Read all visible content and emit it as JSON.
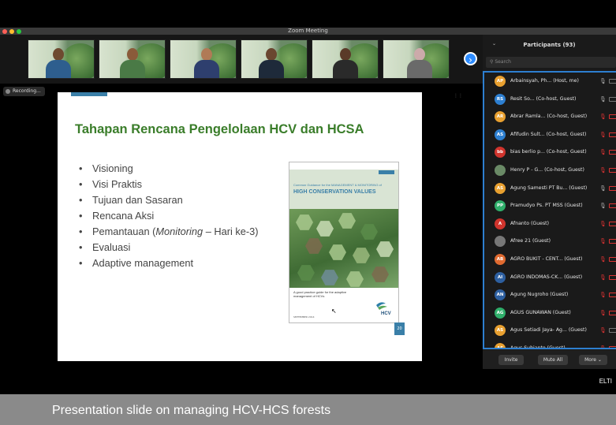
{
  "window": {
    "title": "Zoom Meeting"
  },
  "recording": {
    "label": "Recording..."
  },
  "thumbnails": [
    {
      "name": "",
      "shirt": "#2e5e8e",
      "skin": "#6e4a30"
    },
    {
      "name": "",
      "shirt": "#4a7a46",
      "skin": "#8a5b3a"
    },
    {
      "name": "",
      "shirt": "#2e3f6e",
      "skin": "#b07a56"
    },
    {
      "name": "",
      "shirt": "#1e2a3a",
      "skin": "#6a4630"
    },
    {
      "name": "",
      "shirt": "#2a2a2a",
      "skin": "#5a3a28"
    },
    {
      "name": "",
      "shirt": "#6a6a6a",
      "skin": "#caa"
    }
  ],
  "slide": {
    "title": "Tahapan Rencana Pengelolaan HCV dan HCSA",
    "bullets": [
      "Visioning",
      "Visi Praktis",
      "Tujuan dan Sasaran",
      "Rencana Aksi",
      "Evaluasi",
      "Adaptive management"
    ],
    "bullet_monitoring": {
      "before": "Pemantauan (",
      "italic": "Monitoring",
      "after": " – Hari ke-3)"
    },
    "page_number": "20",
    "book": {
      "small_title": "Common Guidance for the MANAGEMENT & MONITORING of",
      "big_title": "HIGH CONSERVATION VALUES",
      "description": "A good practice guide for the adaptive management of HCVs",
      "date": "SEPTEMBER 2014",
      "logo_text": "HCV"
    }
  },
  "participants": {
    "header": "Participants (93)",
    "search_placeholder": "Search",
    "list": [
      {
        "initials": "AP",
        "color": "#e8a030",
        "name": "Arbainsyah, Ph... (Host, me)",
        "mic": "on",
        "video": "on",
        "photo": false
      },
      {
        "initials": "RS",
        "color": "#2d7fd0",
        "name": "Resit So... (Co-host, Guest)",
        "mic": "on",
        "video": "on",
        "photo": false
      },
      {
        "initials": "AR",
        "color": "#e8a030",
        "name": "Abrar Ramla... (Co-host, Guest)",
        "mic": "muted",
        "video": "off",
        "photo": false
      },
      {
        "initials": "AS",
        "color": "#2d7fd0",
        "name": "Afifudin Sult... (Co-host, Guest)",
        "mic": "muted",
        "video": "off",
        "photo": false
      },
      {
        "initials": "bb",
        "color": "#d0342d",
        "name": "bias berlio p... (Co-host, Guest)",
        "mic": "muted",
        "video": "off",
        "photo": false
      },
      {
        "initials": "",
        "color": "#6a8a66",
        "name": "Henry P - G... (Co-host, Guest)",
        "mic": "muted",
        "video": "off",
        "photo": true
      },
      {
        "initials": "AS",
        "color": "#e8a030",
        "name": "Agung Samesti PT Bu... (Guest)",
        "mic": "on",
        "video": "off",
        "photo": false
      },
      {
        "initials": "PP",
        "color": "#2fae6a",
        "name": "Pramudyo Ps. PT MSS (Guest)",
        "mic": "on",
        "video": "off",
        "photo": false
      },
      {
        "initials": "A",
        "color": "#d0342d",
        "name": "Afnanto (Guest)",
        "mic": "muted",
        "video": "off",
        "photo": false
      },
      {
        "initials": "",
        "color": "#777",
        "name": "Afree 21 (Guest)",
        "mic": "muted",
        "video": "off",
        "photo": true
      },
      {
        "initials": "AB",
        "color": "#e06a30",
        "name": "AGRO BUKIT - CENT... (Guest)",
        "mic": "muted",
        "video": "off",
        "photo": false
      },
      {
        "initials": "AI",
        "color": "#2d5fa0",
        "name": "AGRO INDOMAS-CK... (Guest)",
        "mic": "muted",
        "video": "off",
        "photo": false
      },
      {
        "initials": "AN",
        "color": "#2d5fa0",
        "name": "Agung Nugroho (Guest)",
        "mic": "muted",
        "video": "off",
        "photo": false
      },
      {
        "initials": "AG",
        "color": "#2fae6a",
        "name": "AGUS GUNAWAN (Guest)",
        "mic": "muted",
        "video": "off",
        "photo": false
      },
      {
        "initials": "AS",
        "color": "#e8a030",
        "name": "Agus Setiadi Jaya- Ag... (Guest)",
        "mic": "muted",
        "video": "on",
        "photo": false
      },
      {
        "initials": "AS",
        "color": "#e8a030",
        "name": "Agus Subianto (Guest)",
        "mic": "muted",
        "video": "off",
        "photo": false
      }
    ],
    "buttons": {
      "invite": "Invite",
      "mute_all": "Mute All",
      "more": "More ⌄"
    }
  },
  "watermark": "ELTI",
  "caption": "Presentation slide on managing HCV-HCS forests"
}
